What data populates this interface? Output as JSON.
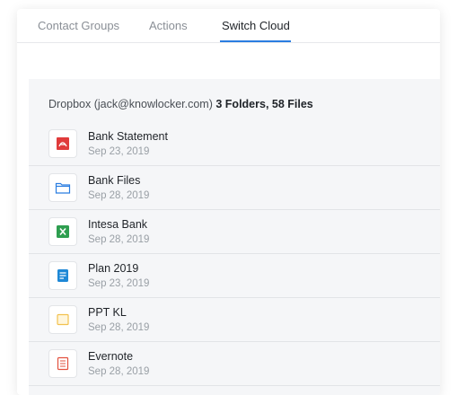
{
  "tabs": [
    {
      "label": "Contact Groups",
      "active": false
    },
    {
      "label": "Actions",
      "active": false
    },
    {
      "label": "Switch Cloud",
      "active": true
    }
  ],
  "summary": {
    "account": "Dropbox (jack@knowlocker.com)",
    "counts": "3 Folders, 58 Files"
  },
  "files": [
    {
      "name": "Bank Statement",
      "date": "Sep 23, 2019",
      "icon": "pdf-icon",
      "color": "#e03b3b"
    },
    {
      "name": "Bank Files",
      "date": "Sep 28, 2019",
      "icon": "folder-icon",
      "color": "#2a7de1"
    },
    {
      "name": "Intesa Bank",
      "date": "Sep 28, 2019",
      "icon": "excel-icon",
      "color": "#2e9e4f"
    },
    {
      "name": "Plan 2019",
      "date": "Sep 23, 2019",
      "icon": "doc-icon",
      "color": "#1e88d6"
    },
    {
      "name": "PPT KL",
      "date": "Sep 28, 2019",
      "icon": "slides-icon",
      "color": "#f2c14e"
    },
    {
      "name": "Evernote",
      "date": "Sep 28, 2019",
      "icon": "note-icon",
      "color": "#e2503e"
    }
  ],
  "colors": {
    "accent": "#2a7de1",
    "panel": "#f5f6f8"
  }
}
